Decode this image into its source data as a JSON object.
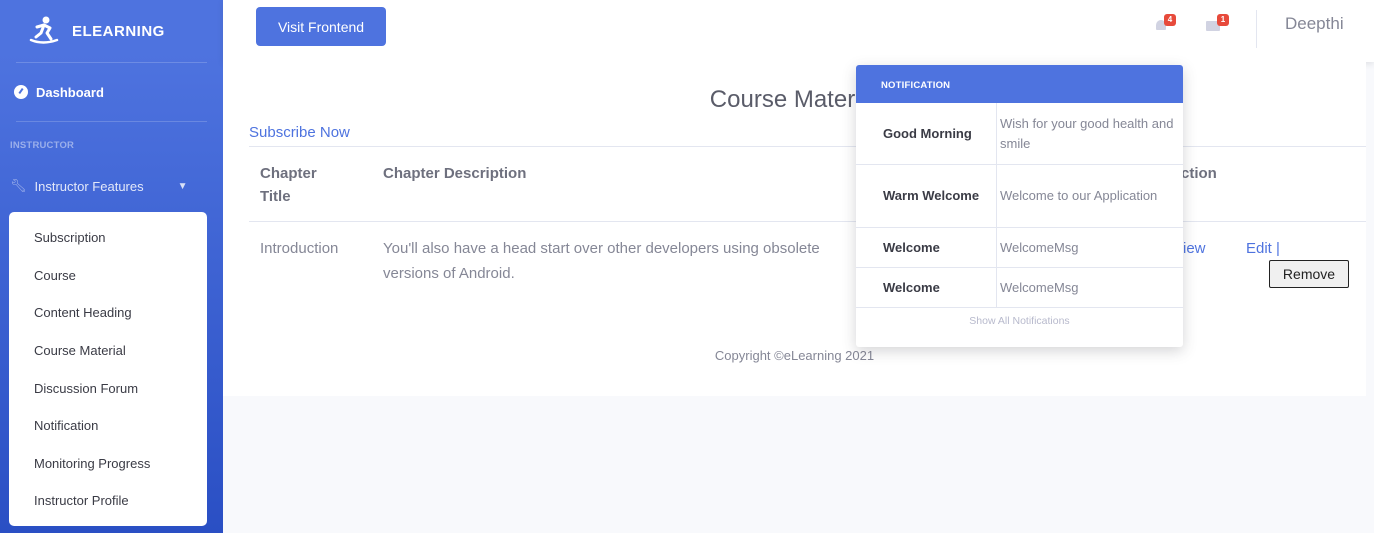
{
  "sidebar": {
    "brand": "ELEARNING",
    "dashboard": "Dashboard",
    "heading": "INSTRUCTOR",
    "features_label": "Instructor Features",
    "submenu": [
      "Subscription",
      "Course",
      "Content Heading",
      "Course Material",
      "Discussion Forum",
      "Notification",
      "Monitoring Progress",
      "Instructor Profile"
    ],
    "color": "#4e73df"
  },
  "topbar": {
    "visit_button": "Visit Frontend",
    "alerts_count": "4",
    "messages_count": "1",
    "username": "Deepthi"
  },
  "main": {
    "title": "Course Material",
    "subscribe_link": "Subscribe Now",
    "table": {
      "headers": [
        "Chapter Title",
        "Chapter Description",
        "ction"
      ],
      "rows": [
        {
          "title": "Introduction",
          "description": "You'll also have a head start over other developers using obsolete versions of Android.",
          "view_link": "iew",
          "edit_link": "Edit |",
          "remove_button": "Remove"
        }
      ]
    }
  },
  "footer": {
    "copyright": "Copyright ©eLearning 2021"
  },
  "notifications": {
    "header": "NOTIFICATION",
    "items": [
      {
        "title": "Good Morning",
        "message": "Wish for your good health and smile"
      },
      {
        "title": "Warm Welcome",
        "message": "Welcome to our Application"
      },
      {
        "title": "Welcome",
        "message": "WelcomeMsg"
      },
      {
        "title": "Welcome",
        "message": "WelcomeMsg"
      }
    ],
    "show_all": "Show All Notifications"
  }
}
